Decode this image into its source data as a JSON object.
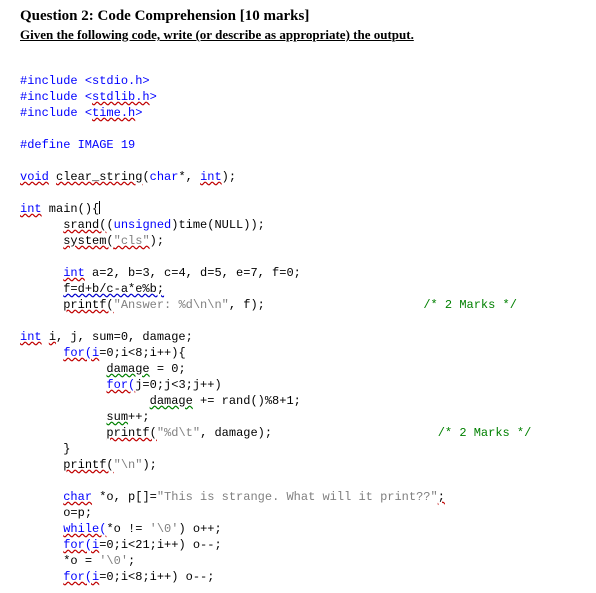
{
  "heading": {
    "title": "Question 2: Code Comprehension [10 marks]",
    "subtitle": "Given the following code, write (or describe as appropriate) the output."
  },
  "c": {
    "include": "#include",
    "stdio": "<stdio.h>",
    "stdlib": "stdlib.h",
    "timeh": "time.h",
    "lt": "<",
    "gt": ">",
    "define": "#define IMAGE 19",
    "void": "void",
    "clear_string": "clear_string",
    "sig": "(",
    "chars": "char",
    "star": "*",
    "comma_sp": ", ",
    "intkw": "int",
    "rparen_semi": ");",
    "main": " main(){",
    "srand": "srand(",
    "srand_arg1": "(",
    "unsigned": "unsigned",
    "srand_arg2": ")time(NULL));",
    "system": "system(",
    "cls": "\"cls\"",
    "sys_end": ");",
    "decl": " a=2, b=3, c=4, d=5, e=7, f=0;",
    "fexpr": "f=d+b/c-a*e%b;",
    "printf": "printf(",
    "ans": "\"Answer: %d\\n\\n\"",
    "ans_end": ", f);",
    "mark2": "/* 2 Marks */",
    "ijdecl_i": "i",
    "ijdecl_rest": ", j, sum=0, damage;",
    "for1": "for(i",
    "for1b": "=0;i<8;i++){",
    "dmg0": "damage",
    "dmg0b": " = 0;",
    "for2": "for(",
    "for2b": "j=0;j<3;j++)",
    "dmginc": "damage",
    "dmginc_b": " += rand()%8+1;",
    "sumpp": "sum",
    "sumpp_b": "++;",
    "printf2_mid": "\"%d\\t\"",
    "printf2_end": ", damage);",
    "rbrace": "}",
    "printf3_mid": "\"\\n\"",
    "printf3_end": ");",
    "char": "char",
    "pdecl": " *o, p[]=",
    "pstr": "\"This is strange. What will it print??\"",
    "pdecl_end": ";",
    "op": "o=p;",
    "while": "while(",
    "while_b": "*o != ",
    "nul": "'\\0'",
    "while_c": ") o++;",
    "for3": "for(i",
    "for3b": "=0;i<21;i++) o--;",
    "starO": "*o = ",
    "starO_end": ";",
    "for4": "for(i",
    "for4b": "=0;i<8;i++) o--;"
  }
}
